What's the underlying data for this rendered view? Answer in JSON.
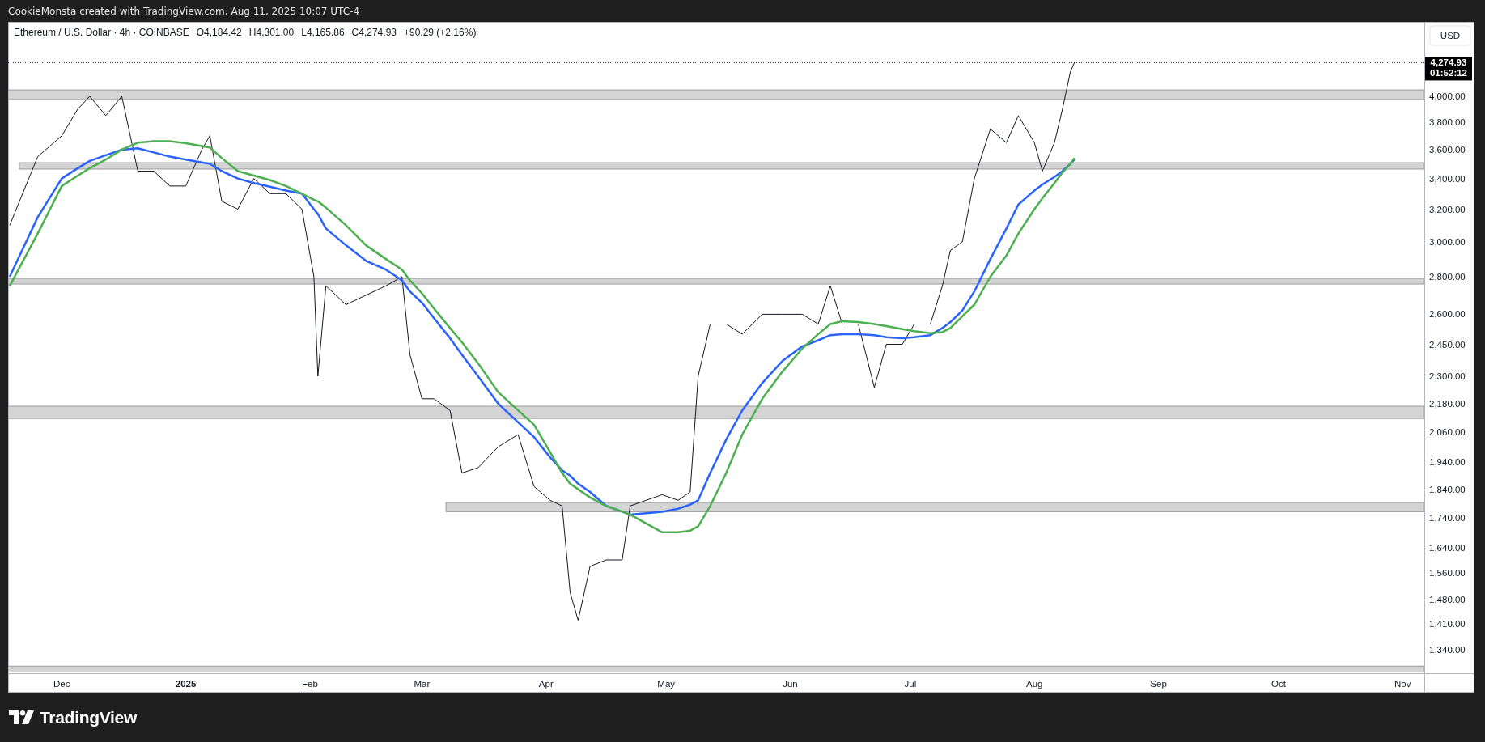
{
  "header": {
    "attribution": "CookieMonsta created with TradingView.com, Aug 11, 2025 10:07 UTC-4"
  },
  "legend": {
    "symbol": "Ethereum / U.S. Dollar · 4h · COINBASE",
    "ohlc": [
      {
        "label": "O",
        "value": "4,184.42"
      },
      {
        "label": "H",
        "value": "4,301.00"
      },
      {
        "label": "L",
        "value": "4,165.86"
      },
      {
        "label": "C",
        "value": "4,274.93"
      }
    ],
    "change": "+90.29 (+2.16%)"
  },
  "price_axis": {
    "currency": "USD",
    "last_price": "4,274.93",
    "countdown": "01:52:12",
    "ticks": [
      "4,000.00",
      "3,800.00",
      "3,600.00",
      "3,400.00",
      "3,200.00",
      "3,000.00",
      "2,800.00",
      "2,600.00",
      "2,450.00",
      "2,300.00",
      "2,180.00",
      "2,060.00",
      "1,940.00",
      "1,840.00",
      "1,740.00",
      "1,640.00",
      "1,560.00",
      "1,480.00",
      "1,410.00",
      "1,340.00"
    ]
  },
  "time_axis": {
    "labels": [
      "Dec",
      "2025",
      "Feb",
      "Mar",
      "Apr",
      "May",
      "Jun",
      "Jul",
      "Aug",
      "Sep",
      "Oct",
      "Nov"
    ]
  },
  "footer": {
    "brand": "TradingView"
  }
}
